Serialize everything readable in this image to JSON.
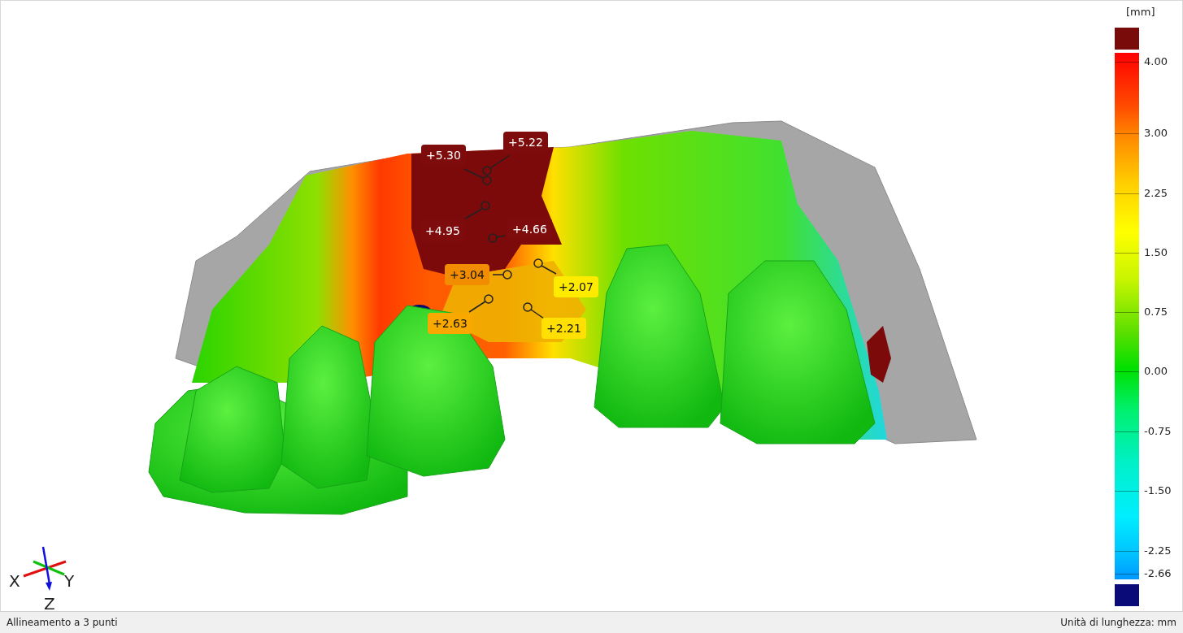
{
  "viewport": {
    "annotations": [
      {
        "label": "+5.30",
        "color": "#7f0c0c"
      },
      {
        "label": "+5.22",
        "color": "#7f0c0c"
      },
      {
        "label": "+4.95",
        "color": "#7f0c0c"
      },
      {
        "label": "+4.66",
        "color": "#7f0c0c"
      },
      {
        "label": "+3.04",
        "color": "#f28c00"
      },
      {
        "label": "+2.07",
        "color": "#ffeb00"
      },
      {
        "label": "+2.63",
        "color": "#f9a800"
      },
      {
        "label": "+2.21",
        "color": "#ffe000"
      }
    ],
    "axes": [
      "X",
      "Y",
      "Z"
    ]
  },
  "legend": {
    "unit": "[mm]",
    "ticks": [
      "4.00",
      "3.00",
      "2.25",
      "1.50",
      "0.75",
      "0.00",
      "-0.75",
      "-1.50",
      "-2.25",
      "-2.66"
    ]
  },
  "status_bar": {
    "left": "Allineamento a 3 punti",
    "right": "Unità di lunghezza: mm"
  }
}
